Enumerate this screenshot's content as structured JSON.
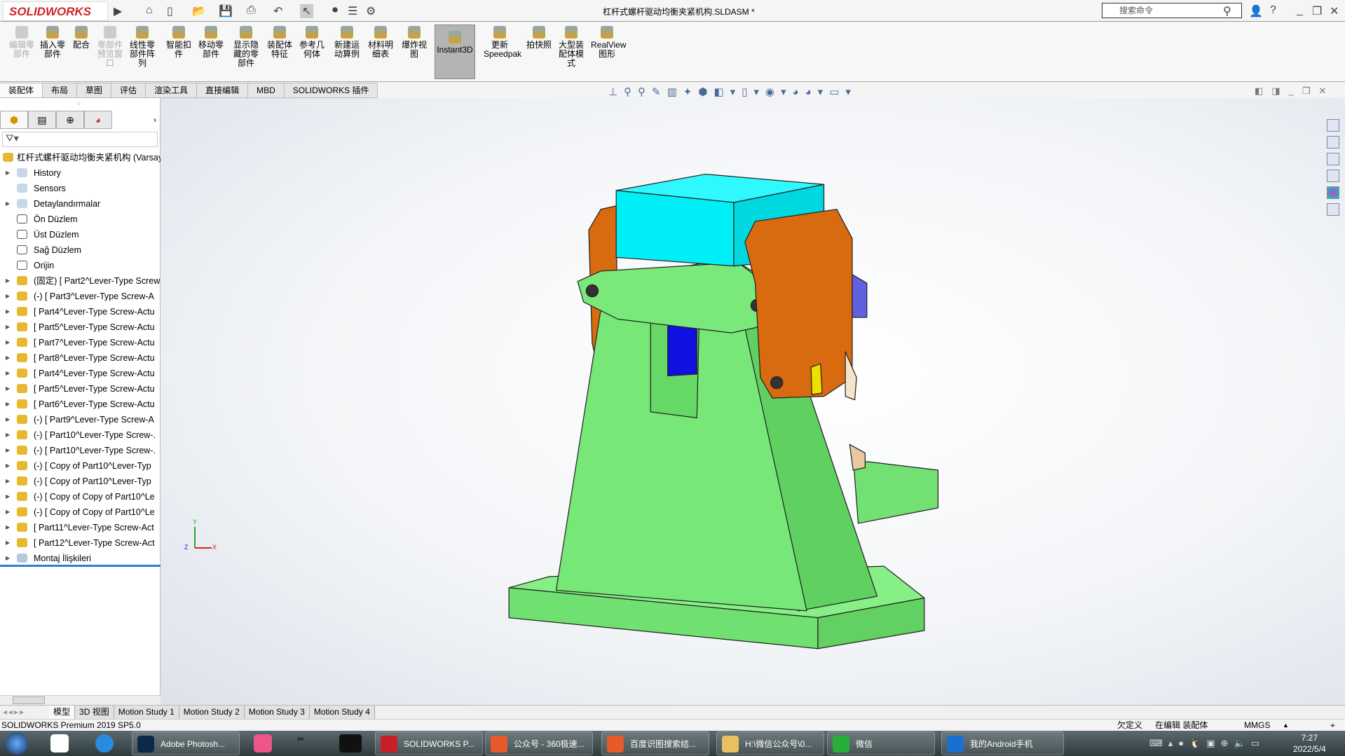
{
  "app": {
    "logo": "SOLIDWORKS",
    "title": "杠杆式螺杆驱动均衡夹紧机构.SLDASM *",
    "search_placeholder": "搜索命令"
  },
  "ribbon": [
    {
      "label": "编辑零部件",
      "icon": "edit-component-icon",
      "disabled": true
    },
    {
      "label": "插入零部件",
      "icon": "insert-component-icon"
    },
    {
      "label": "配合",
      "icon": "mate-icon"
    },
    {
      "label": "零部件预览窗口",
      "icon": "component-preview-icon",
      "disabled": true
    },
    {
      "label": "线性零部件阵列",
      "icon": "linear-pattern-icon"
    },
    {
      "label": "智能扣件",
      "icon": "smart-fasteners-icon"
    },
    {
      "label": "移动零部件",
      "icon": "move-component-icon"
    },
    {
      "label": "显示隐藏的零部件",
      "icon": "show-hidden-icon"
    },
    {
      "label": "装配体特征",
      "icon": "assembly-feature-icon"
    },
    {
      "label": "参考几何体",
      "icon": "reference-geometry-icon"
    },
    {
      "label": "新建运动算例",
      "icon": "new-motion-study-icon"
    },
    {
      "label": "材料明细表",
      "icon": "bom-icon"
    },
    {
      "label": "爆炸视图",
      "icon": "exploded-view-icon"
    },
    {
      "label": "Instant3D",
      "icon": "instant3d-icon",
      "selected": true
    },
    {
      "label": "更新Speedpak",
      "icon": "speedpak-icon"
    },
    {
      "label": "拍快照",
      "icon": "snapshot-icon"
    },
    {
      "label": "大型装配体模式",
      "icon": "large-assembly-icon"
    },
    {
      "label": "RealView图形",
      "icon": "realview-icon"
    }
  ],
  "command_tabs": [
    "装配体",
    "布局",
    "草图",
    "评估",
    "渲染工具",
    "直接编辑",
    "MBD",
    "SOLIDWORKS 插件"
  ],
  "tree": {
    "root": "杠杆式螺杆驱动均衡夹紧机构  (Varsay",
    "items": [
      {
        "label": "History",
        "kind": "folder",
        "exp": true
      },
      {
        "label": "Sensors",
        "kind": "folder"
      },
      {
        "label": "Detaylandırmalar",
        "kind": "folder",
        "exp": true
      },
      {
        "label": "Ön Düzlem",
        "kind": "plane"
      },
      {
        "label": "Üst Düzlem",
        "kind": "plane"
      },
      {
        "label": "Sağ Düzlem",
        "kind": "plane"
      },
      {
        "label": "Orijin",
        "kind": "origin"
      },
      {
        "label": "(固定) [ Part2^Lever-Type Screw",
        "kind": "part",
        "exp": true
      },
      {
        "label": "(-) [ Part3^Lever-Type Screw-A",
        "kind": "part",
        "exp": true
      },
      {
        "label": "[ Part4^Lever-Type Screw-Actu",
        "kind": "part",
        "exp": true
      },
      {
        "label": "[ Part5^Lever-Type Screw-Actu",
        "kind": "part",
        "exp": true
      },
      {
        "label": "[ Part7^Lever-Type Screw-Actu",
        "kind": "part",
        "exp": true
      },
      {
        "label": "[ Part8^Lever-Type Screw-Actu",
        "kind": "part",
        "exp": true
      },
      {
        "label": "[ Part4^Lever-Type Screw-Actu",
        "kind": "part",
        "exp": true
      },
      {
        "label": "[ Part5^Lever-Type Screw-Actu",
        "kind": "part",
        "exp": true
      },
      {
        "label": "[ Part6^Lever-Type Screw-Actu",
        "kind": "part",
        "exp": true
      },
      {
        "label": "(-) [ Part9^Lever-Type Screw-A",
        "kind": "part",
        "exp": true
      },
      {
        "label": "(-) [ Part10^Lever-Type Screw-.",
        "kind": "part",
        "exp": true
      },
      {
        "label": "(-) [ Part10^Lever-Type Screw-.",
        "kind": "part",
        "exp": true
      },
      {
        "label": "(-) [ Copy of Part10^Lever-Typ",
        "kind": "part",
        "exp": true
      },
      {
        "label": "(-) [ Copy of Part10^Lever-Typ",
        "kind": "part",
        "exp": true
      },
      {
        "label": "(-) [ Copy of Copy of Part10^Le",
        "kind": "part",
        "exp": true
      },
      {
        "label": "(-) [ Copy of Copy of Part10^Le",
        "kind": "part",
        "exp": true
      },
      {
        "label": "[ Part11^Lever-Type Screw-Act",
        "kind": "part",
        "exp": true
      },
      {
        "label": "[ Part12^Lever-Type Screw-Act",
        "kind": "part",
        "exp": true
      },
      {
        "label": "Montaj İlişkileri",
        "kind": "mates",
        "exp": true
      }
    ]
  },
  "triad": {
    "x": "X",
    "y": "Y",
    "z": "Z"
  },
  "bottom_tabs": [
    "模型",
    "3D 视图",
    "Motion Study 1",
    "Motion Study 2",
    "Motion Study 3",
    "Motion Study 4"
  ],
  "status": {
    "product": "SOLIDWORKS Premium 2019 SP5.0",
    "definition": "欠定义",
    "mode": "在编辑 装配体",
    "units": "MMGS"
  },
  "taskbar": {
    "items": [
      {
        "label": "Adobe Photosh...",
        "color": "#0b2a4a"
      },
      {
        "label": "SOLIDWORKS P...",
        "color": "#c8202a"
      },
      {
        "label": "公众号 - 360极速...",
        "color": "#e85a2a"
      },
      {
        "label": "百度识图搜索结...",
        "color": "#e85a2a"
      },
      {
        "label": "H:\\微信公众号\\0...",
        "color": "#e8c060"
      },
      {
        "label": "微信",
        "color": "#2aae3a"
      },
      {
        "label": "我的Android手机",
        "color": "#1a70d0"
      }
    ],
    "time": "7:27",
    "date": "2022/5/4"
  },
  "colors": {
    "green": "#77e777",
    "cyan": "#00f0f8",
    "orange": "#d86a10",
    "blue": "#1010e0"
  }
}
